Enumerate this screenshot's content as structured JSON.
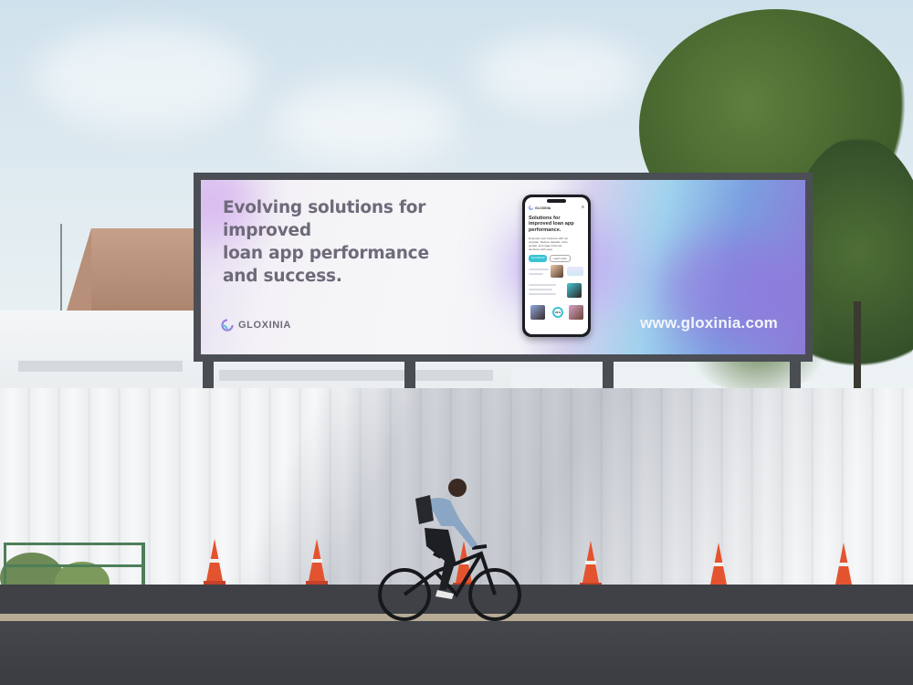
{
  "billboard": {
    "headline_lines": [
      "Evolving solutions for improved",
      "loan app performance",
      "and success."
    ],
    "brand_name": "GLOXINIA",
    "url": "www.gloxinia.com"
  },
  "phone": {
    "brand_name": "GLOXINIA",
    "title_lines": [
      "Solutions for",
      "improved loan app",
      "performance."
    ],
    "body_lines": [
      "Empower your business with our",
      "program. Reduce defaults, drive",
      "growth, and make informed",
      "decisions with ease."
    ],
    "primary_button": "Get Started",
    "secondary_button": "Learn more",
    "stat": "90%"
  },
  "colors": {
    "billboard_frame": "#4b4e55",
    "headline": "#6f6a7a",
    "brand_accent": "#3ac3d4",
    "gradient_blue": "#7ba0e0",
    "gradient_purple": "#8e7bd8",
    "cone": "#e4532f",
    "rail": "#4d7f59"
  }
}
